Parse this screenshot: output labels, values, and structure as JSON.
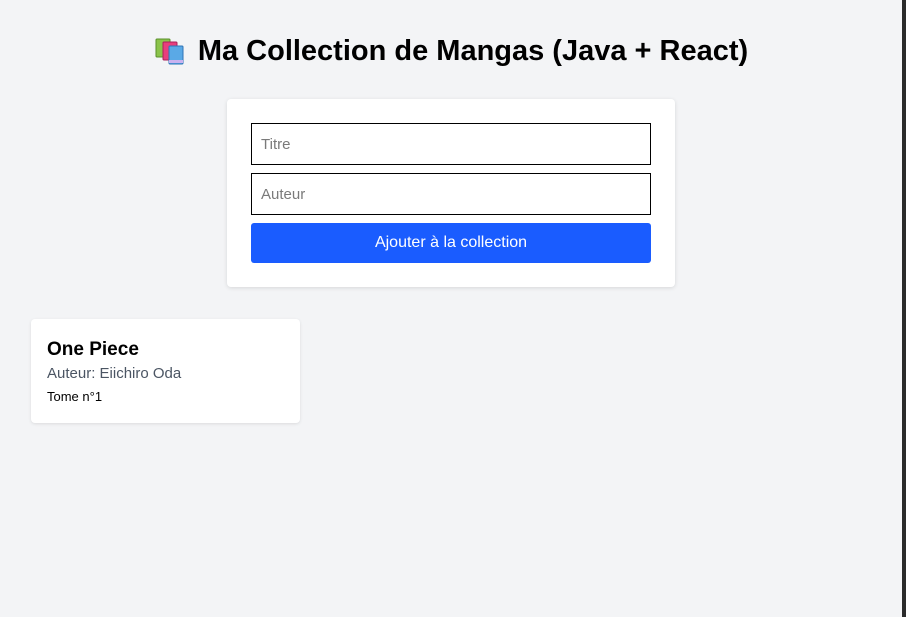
{
  "header": {
    "icon": "books-icon",
    "title": "Ma Collection de Mangas (Java + React)"
  },
  "form": {
    "title_placeholder": "Titre",
    "author_placeholder": "Auteur",
    "title_value": "",
    "author_value": "",
    "submit_label": "Ajouter à la collection"
  },
  "colors": {
    "background": "#f3f4f6",
    "primary_button": "#1a5cff",
    "card": "#ffffff",
    "secondary_text": "#4b5563"
  },
  "collection": [
    {
      "title": "One Piece",
      "author": "Auteur: Eiichiro Oda",
      "volume": "Tome n°1"
    }
  ]
}
